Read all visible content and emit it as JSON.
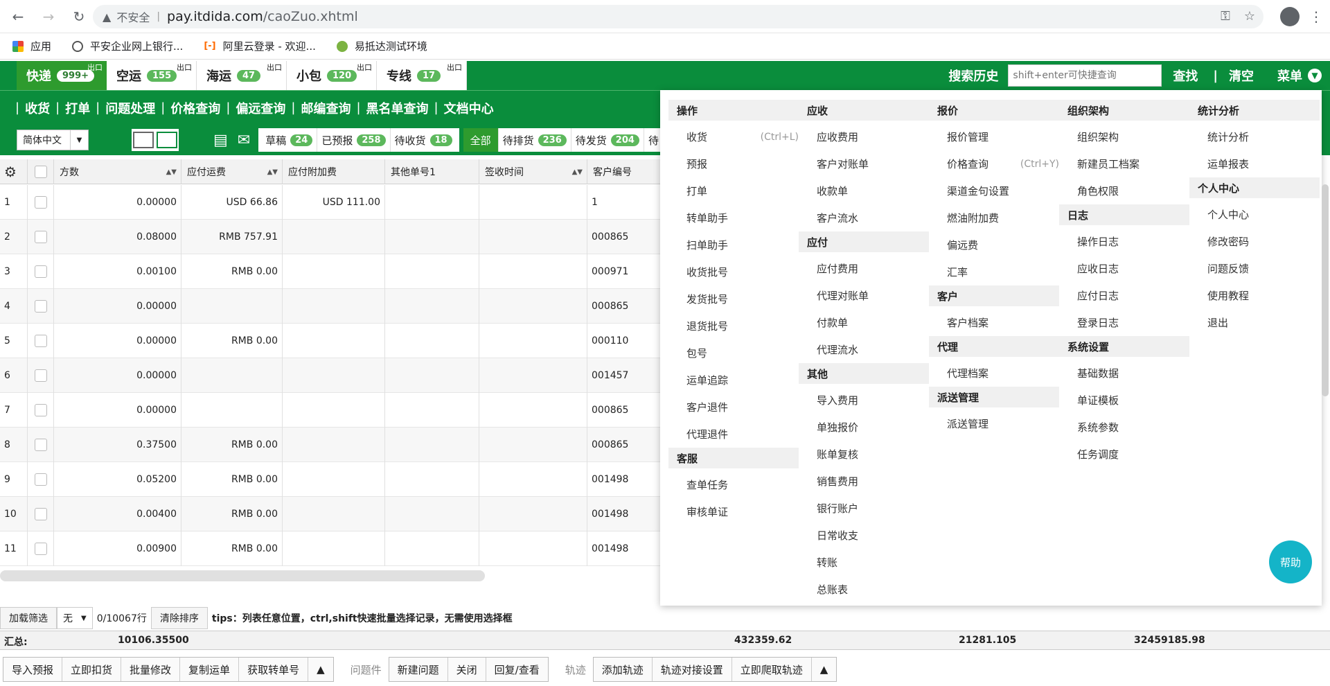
{
  "browser": {
    "insecure_label": "不安全",
    "url_host": "pay.itdida.com",
    "url_path": "/caoZuo.xhtml",
    "bookmarks": [
      {
        "label": "应用",
        "icon": "apps-icon"
      },
      {
        "label": "平安企业网上银行...",
        "icon": "globe-icon"
      },
      {
        "label": "阿里云登录 - 欢迎...",
        "icon": "ali-icon"
      },
      {
        "label": "易抵达测试环境",
        "icon": "yi-icon"
      }
    ]
  },
  "mode_tabs": [
    {
      "label": "快递",
      "count": "999+",
      "sup": "出口"
    },
    {
      "label": "空运",
      "count": "155",
      "sup": "出口"
    },
    {
      "label": "海运",
      "count": "47",
      "sup": "出口"
    },
    {
      "label": "小包",
      "count": "120",
      "sup": "出口"
    },
    {
      "label": "专线",
      "count": "17",
      "sup": "出口"
    }
  ],
  "header": {
    "search_history": "搜索历史",
    "search_placeholder": "shift+enter可快捷查询",
    "find": "查找",
    "separator": "|",
    "clear": "清空",
    "menu": "菜单"
  },
  "nav": [
    "收货",
    "打单",
    "问题处理",
    "价格查询",
    "偏远查询",
    "邮编查询",
    "黑名单查询",
    "文档中心"
  ],
  "toolbar": {
    "language": "简体中文",
    "status_a": [
      {
        "label": "草稿",
        "count": "24"
      },
      {
        "label": "已预报",
        "count": "258"
      },
      {
        "label": "待收货",
        "count": "18"
      }
    ],
    "status_b": [
      {
        "label": "全部",
        "count": ""
      },
      {
        "label": "待排货",
        "count": "236"
      },
      {
        "label": "待发货",
        "count": "204"
      },
      {
        "label": "待",
        "count": ""
      }
    ]
  },
  "grid": {
    "columns": [
      "方数",
      "应付运费",
      "应付附加费",
      "其他单号1",
      "签收时间",
      "客户编号"
    ],
    "rows": [
      {
        "idx": "1",
        "fang": "0.00000",
        "yf": "USD 66.86",
        "fj": "USD 111.00",
        "kh": "1"
      },
      {
        "idx": "2",
        "fang": "0.08000",
        "yf": "RMB 757.91",
        "fj": "",
        "kh": "000865"
      },
      {
        "idx": "3",
        "fang": "0.00100",
        "yf": "RMB 0.00",
        "fj": "",
        "kh": "000971"
      },
      {
        "idx": "4",
        "fang": "0.00000",
        "yf": "",
        "fj": "",
        "kh": "000865"
      },
      {
        "idx": "5",
        "fang": "0.00000",
        "yf": "RMB 0.00",
        "fj": "",
        "kh": "000110"
      },
      {
        "idx": "6",
        "fang": "0.00000",
        "yf": "",
        "fj": "",
        "kh": "001457"
      },
      {
        "idx": "7",
        "fang": "0.00000",
        "yf": "",
        "fj": "",
        "kh": "000865"
      },
      {
        "idx": "8",
        "fang": "0.37500",
        "yf": "RMB 0.00",
        "fj": "",
        "kh": "000865"
      },
      {
        "idx": "9",
        "fang": "0.05200",
        "yf": "RMB 0.00",
        "fj": "",
        "kh": "001498"
      },
      {
        "idx": "10",
        "fang": "0.00400",
        "yf": "RMB 0.00",
        "fj": "",
        "kh": "001498"
      },
      {
        "idx": "11",
        "fang": "0.00900",
        "yf": "RMB 0.00",
        "fj": "",
        "kh": "001498"
      }
    ]
  },
  "filter_bar": {
    "load_filter": "加载筛选",
    "none": "无",
    "rowcount": "0/10067行",
    "clear_sort": "清除排序",
    "tips": "tips：列表任意位置，ctrl,shift快速批量选择记录，无需使用选择框"
  },
  "summary": {
    "label": "汇总:",
    "v1": "10106.35500",
    "v2": "432359.62",
    "v3": "21281.105",
    "v4": "32459185.98"
  },
  "bottom": {
    "group1": [
      "导入预报",
      "立即扣货",
      "批量修改",
      "复制运单",
      "获取转单号",
      "▲"
    ],
    "label_problem": "问题件",
    "group2": [
      "新建问题",
      "关闭",
      "回复/查看"
    ],
    "label_track": "轨迹",
    "group3": [
      "添加轨迹",
      "轨迹对接设置",
      "立即爬取轨迹",
      "▲"
    ]
  },
  "mega_menu": {
    "col1": [
      {
        "type": "sec",
        "label": "操作"
      },
      {
        "type": "item",
        "label": "收货",
        "shortcut": "(Ctrl+L)"
      },
      {
        "type": "item",
        "label": "预报"
      },
      {
        "type": "item",
        "label": "打单"
      },
      {
        "type": "item",
        "label": "转单助手"
      },
      {
        "type": "item",
        "label": "扫单助手"
      },
      {
        "type": "item",
        "label": "收货批号"
      },
      {
        "type": "item",
        "label": "发货批号"
      },
      {
        "type": "item",
        "label": "退货批号"
      },
      {
        "type": "item",
        "label": "包号"
      },
      {
        "type": "item",
        "label": "运单追踪"
      },
      {
        "type": "item",
        "label": "客户退件"
      },
      {
        "type": "item",
        "label": "代理退件"
      },
      {
        "type": "sec",
        "label": "客服"
      },
      {
        "type": "item",
        "label": "查单任务"
      },
      {
        "type": "item",
        "label": "审核单证"
      }
    ],
    "col2": [
      {
        "type": "sec",
        "label": "应收"
      },
      {
        "type": "item",
        "label": "应收费用"
      },
      {
        "type": "item",
        "label": "客户对账单"
      },
      {
        "type": "item",
        "label": "收款单"
      },
      {
        "type": "item",
        "label": "客户流水"
      },
      {
        "type": "sec",
        "label": "应付"
      },
      {
        "type": "item",
        "label": "应付费用"
      },
      {
        "type": "item",
        "label": "代理对账单"
      },
      {
        "type": "item",
        "label": "付款单"
      },
      {
        "type": "item",
        "label": "代理流水"
      },
      {
        "type": "sec",
        "label": "其他"
      },
      {
        "type": "item",
        "label": "导入费用"
      },
      {
        "type": "item",
        "label": "单独报价"
      },
      {
        "type": "item",
        "label": "账单复核"
      },
      {
        "type": "item",
        "label": "销售费用"
      },
      {
        "type": "item",
        "label": "银行账户"
      },
      {
        "type": "item",
        "label": "日常收支"
      },
      {
        "type": "item",
        "label": "转账"
      },
      {
        "type": "item",
        "label": "总账表"
      }
    ],
    "col3": [
      {
        "type": "sec",
        "label": "报价"
      },
      {
        "type": "item",
        "label": "报价管理"
      },
      {
        "type": "item",
        "label": "价格查询",
        "shortcut": "(Ctrl+Y)"
      },
      {
        "type": "item",
        "label": "渠道金句设置"
      },
      {
        "type": "item",
        "label": "燃油附加费"
      },
      {
        "type": "item",
        "label": "偏远费"
      },
      {
        "type": "item",
        "label": "汇率"
      },
      {
        "type": "sec",
        "label": "客户"
      },
      {
        "type": "item",
        "label": "客户档案"
      },
      {
        "type": "sec",
        "label": "代理"
      },
      {
        "type": "item",
        "label": "代理档案"
      },
      {
        "type": "sec",
        "label": "派送管理"
      },
      {
        "type": "item",
        "label": "派送管理"
      }
    ],
    "col4": [
      {
        "type": "sec",
        "label": "组织架构"
      },
      {
        "type": "item",
        "label": "组织架构"
      },
      {
        "type": "item",
        "label": "新建员工档案"
      },
      {
        "type": "item",
        "label": "角色权限"
      },
      {
        "type": "sec",
        "label": "日志"
      },
      {
        "type": "item",
        "label": "操作日志"
      },
      {
        "type": "item",
        "label": "应收日志"
      },
      {
        "type": "item",
        "label": "应付日志"
      },
      {
        "type": "item",
        "label": "登录日志"
      },
      {
        "type": "sec",
        "label": "系统设置"
      },
      {
        "type": "item",
        "label": "基础数据"
      },
      {
        "type": "item",
        "label": "单证模板"
      },
      {
        "type": "item",
        "label": "系统参数"
      },
      {
        "type": "item",
        "label": "任务调度"
      }
    ],
    "col5": [
      {
        "type": "sec",
        "label": "统计分析"
      },
      {
        "type": "item",
        "label": "统计分析"
      },
      {
        "type": "item",
        "label": "运单报表"
      },
      {
        "type": "sec",
        "label": "个人中心"
      },
      {
        "type": "item",
        "label": "个人中心"
      },
      {
        "type": "item",
        "label": "修改密码"
      },
      {
        "type": "item",
        "label": "问题反馈"
      },
      {
        "type": "item",
        "label": "使用教程"
      },
      {
        "type": "item",
        "label": "退出"
      }
    ]
  },
  "help": "帮助"
}
